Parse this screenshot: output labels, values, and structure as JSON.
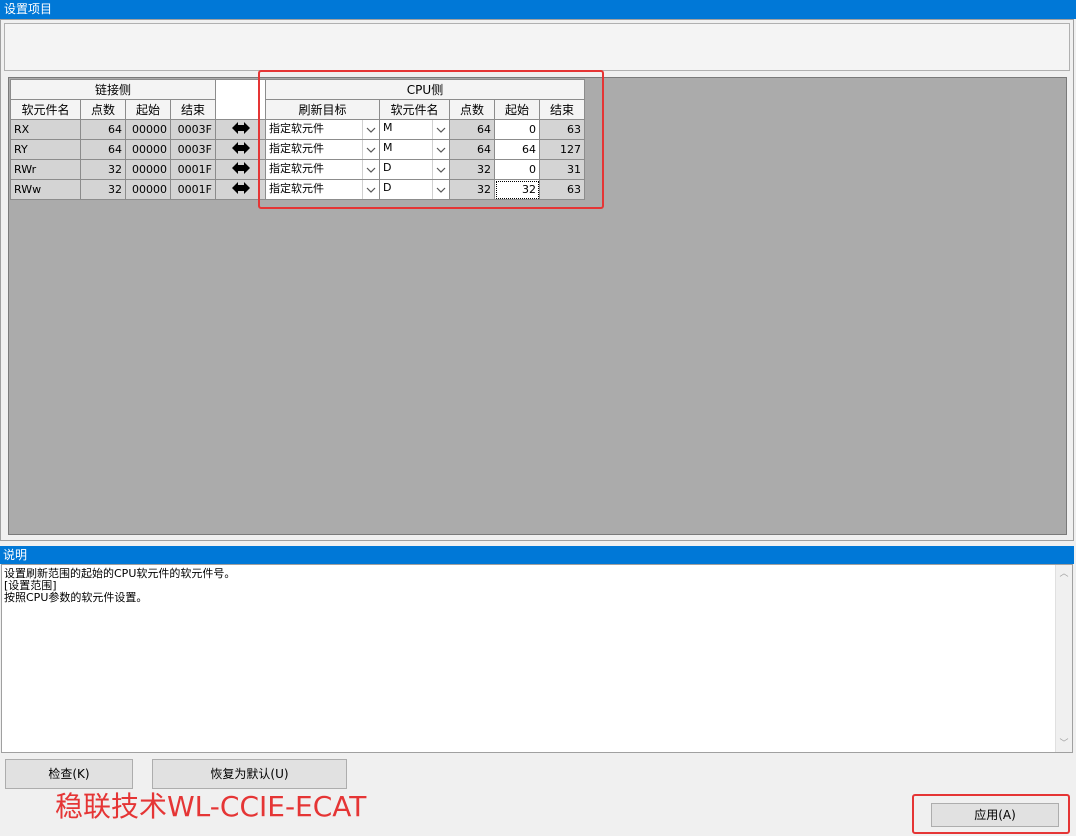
{
  "window": {
    "section_title": "设置项目",
    "description_title": "说明"
  },
  "table": {
    "link_side_header": "链接侧",
    "cpu_side_header": "CPU侧",
    "link_columns": [
      "软元件名",
      "点数",
      "起始",
      "结束"
    ],
    "cpu_columns": [
      "刷新目标",
      "软元件名",
      "点数",
      "起始",
      "结束"
    ],
    "rows": [
      {
        "link_device": "RX",
        "link_points": "64",
        "link_start": "00000",
        "link_end": "0003F",
        "refresh_target": "指定软元件",
        "cpu_device": "M",
        "cpu_points": "64",
        "cpu_start": "0",
        "cpu_end": "63"
      },
      {
        "link_device": "RY",
        "link_points": "64",
        "link_start": "00000",
        "link_end": "0003F",
        "refresh_target": "指定软元件",
        "cpu_device": "M",
        "cpu_points": "64",
        "cpu_start": "64",
        "cpu_end": "127"
      },
      {
        "link_device": "RWr",
        "link_points": "32",
        "link_start": "00000",
        "link_end": "0001F",
        "refresh_target": "指定软元件",
        "cpu_device": "D",
        "cpu_points": "32",
        "cpu_start": "0",
        "cpu_end": "31"
      },
      {
        "link_device": "RWw",
        "link_points": "32",
        "link_start": "00000",
        "link_end": "0001F",
        "refresh_target": "指定软元件",
        "cpu_device": "D",
        "cpu_points": "32",
        "cpu_start": "32",
        "cpu_end": "63"
      }
    ]
  },
  "description": {
    "lines": [
      "设置刷新范围的起始的CPU软元件的软元件号。",
      "[设置范围]",
      "按照CPU参数的软元件设置。"
    ]
  },
  "buttons": {
    "check": "检查(K)",
    "restore_default": "恢复为默认(U)",
    "apply": "应用(A)"
  },
  "watermark": "稳联技术WL-CCIE-ECAT",
  "colors": {
    "accent": "#0078d7",
    "highlight_box": "#e53535",
    "grid_background": "#ababab",
    "readonly_cell": "#d4d4d4"
  },
  "icons": {
    "transfer": "double-arrow-icon",
    "dropdown": "chevron-down-icon"
  }
}
